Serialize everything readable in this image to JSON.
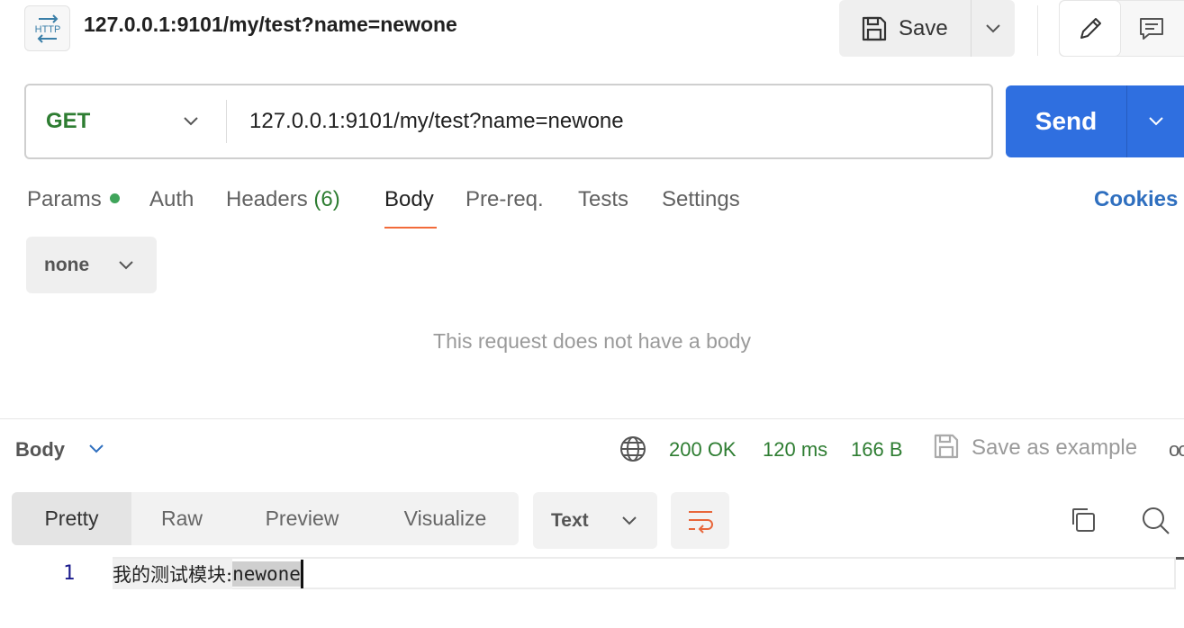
{
  "header": {
    "icon_name": "http-icon",
    "icon_text": "HTTP",
    "title": "127.0.0.1:9101/my/test?name=newone",
    "save_label": "Save"
  },
  "request": {
    "method": "GET",
    "url": "127.0.0.1:9101/my/test?name=newone",
    "send_label": "Send"
  },
  "request_tabs": {
    "params": "Params",
    "auth": "Auth",
    "headers": "Headers",
    "headers_count": "(6)",
    "body": "Body",
    "prereq": "Pre-req.",
    "tests": "Tests",
    "settings": "Settings",
    "active": "Body",
    "cookies": "Cookies"
  },
  "body_panel": {
    "type_selected": "none",
    "empty_message": "This request does not have a body"
  },
  "response": {
    "section_label": "Body",
    "status": "200 OK",
    "time": "120 ms",
    "size": "166 B",
    "save_example": "Save as example",
    "more": "oo",
    "view_tabs": [
      "Pretty",
      "Raw",
      "Preview",
      "Visualize"
    ],
    "active_view": "Pretty",
    "format": "Text",
    "lines": [
      {
        "number": "1",
        "prefix": "我的测试模块: ",
        "highlight": "newone"
      }
    ]
  },
  "colors": {
    "accent_blue": "#2f6fe0",
    "method_green": "#2e7d32",
    "tab_underline": "#f26b3a",
    "status_green": "#2e7d32",
    "cookies_link": "#2f6fbf"
  }
}
